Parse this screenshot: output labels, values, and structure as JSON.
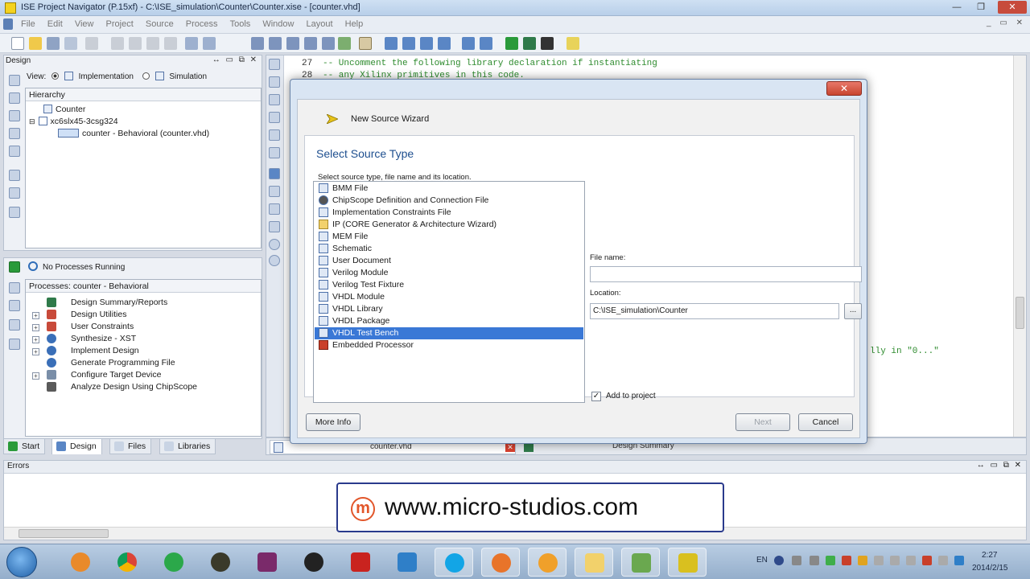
{
  "window": {
    "title": "ISE Project Navigator (P.15xf) - C:\\ISE_simulation\\Counter\\Counter.xise - [counter.vhd]"
  },
  "menu": [
    "File",
    "Edit",
    "View",
    "Project",
    "Source",
    "Process",
    "Tools",
    "Window",
    "Layout",
    "Help"
  ],
  "design_panel": {
    "caption": "Design",
    "view_label": "View:",
    "implementation": "Implementation",
    "simulation": "Simulation",
    "hierarchy_header": "Hierarchy",
    "tree": [
      "Counter",
      "xc6slx45-3csg324",
      "counter - Behavioral (counter.vhd)"
    ]
  },
  "process_panel": {
    "status": "No Processes Running",
    "header": "Processes: counter - Behavioral",
    "items": [
      "Design Summary/Reports",
      "Design Utilities",
      "User Constraints",
      "Synthesize - XST",
      "Implement Design",
      "Generate Programming File",
      "Configure Target Device",
      "Analyze Design Using ChipScope"
    ]
  },
  "left_tabs": [
    "Start",
    "Design",
    "Files",
    "Libraries"
  ],
  "editor": {
    "lines": [
      {
        "num": "27",
        "text": "-- Uncomment the following library declaration if instantiating"
      },
      {
        "num": "28",
        "text": "-- any Xilinx primitives in this code."
      }
    ],
    "partial_text": "lly in \"0...\"",
    "tabs": [
      "counter.vhd",
      "Design Summary"
    ]
  },
  "errors_panel": {
    "caption": "Errors"
  },
  "watermark": {
    "logo": "m",
    "text": "www.micro-studios.com"
  },
  "dialog": {
    "window_title": "New Source Wizard",
    "heading": "Select Source Type",
    "subheading": "Select source type, file name and its location.",
    "source_types": [
      "BMM File",
      "ChipScope Definition and Connection File",
      "Implementation Constraints File",
      "IP (CORE Generator & Architecture Wizard)",
      "MEM File",
      "Schematic",
      "User Document",
      "Verilog Module",
      "Verilog Test Fixture",
      "VHDL Module",
      "VHDL Library",
      "VHDL Package",
      "VHDL Test Bench",
      "Embedded Processor"
    ],
    "selected_index": 12,
    "file_name_label": "File name:",
    "file_name_value": "",
    "location_label": "Location:",
    "location_value": "C:\\ISE_simulation\\Counter",
    "browse_label": "...",
    "add_to_project_label": "Add to project",
    "add_to_project_checked": true,
    "more_info": "More Info",
    "next": "Next",
    "cancel": "Cancel"
  },
  "taskbar": {
    "language": "EN",
    "time": "2:27",
    "date": "2014/2/15"
  }
}
